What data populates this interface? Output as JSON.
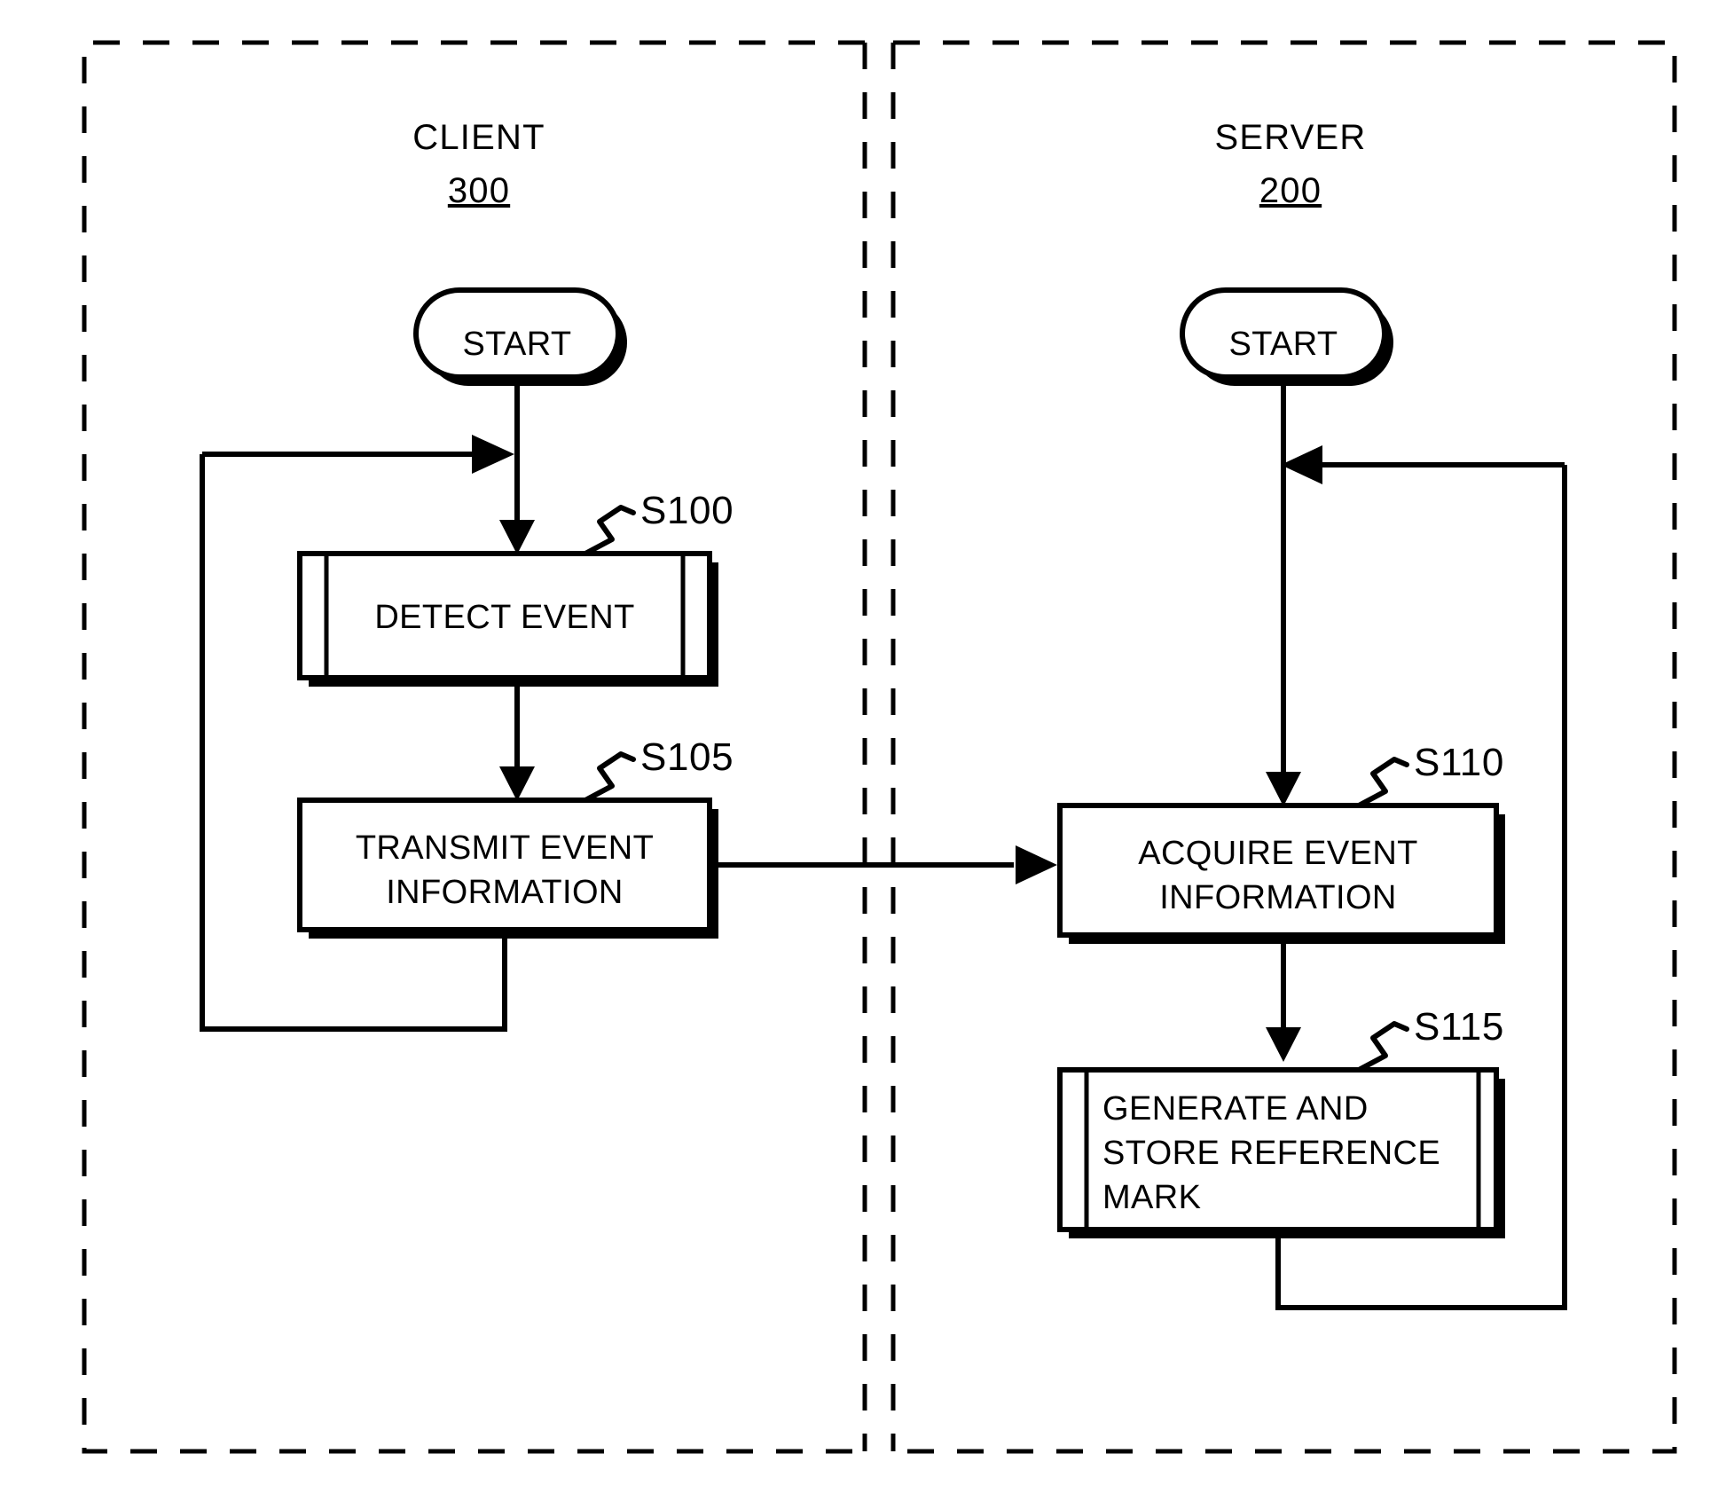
{
  "figure": {
    "type": "patent-flowchart",
    "background_color": "#ffffff",
    "line_color": "#000000"
  },
  "lanes": [
    {
      "id": "client",
      "title": "CLIENT",
      "number": "300"
    },
    {
      "id": "server",
      "title": "SERVER",
      "number": "200"
    }
  ],
  "nodes": {
    "client_start": {
      "label": "START",
      "shape": "terminator"
    },
    "detect_event": {
      "label": "DETECT EVENT",
      "shape": "predefined-process",
      "step": "S100"
    },
    "transmit_event": {
      "line1": "TRANSMIT EVENT",
      "line2": "INFORMATION",
      "shape": "process",
      "step": "S105"
    },
    "server_start": {
      "label": "START",
      "shape": "terminator"
    },
    "acquire_event": {
      "line1": "ACQUIRE EVENT",
      "line2": "INFORMATION",
      "shape": "process",
      "step": "S110"
    },
    "generate_store": {
      "line1": "GENERATE AND",
      "line2": "STORE REFERENCE",
      "line3": "MARK",
      "shape": "predefined-process",
      "step": "S115"
    }
  },
  "step_tags": {
    "s100": "S100",
    "s105": "S105",
    "s110": "S110",
    "s115": "S115"
  }
}
